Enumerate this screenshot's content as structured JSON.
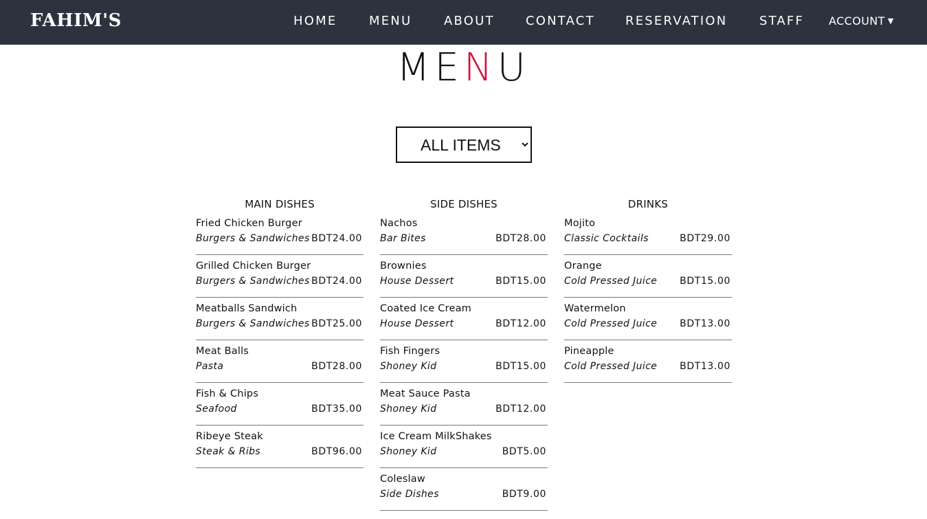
{
  "nav": {
    "brand": "FAHIM'S",
    "links": [
      "HOME",
      "MENU",
      "ABOUT",
      "CONTACT",
      "RESERVATION",
      "STAFF"
    ],
    "account": "ACCOUNT"
  },
  "title": {
    "part1": "ME",
    "accent": "N",
    "part2": "U",
    "accent_color": "#d2163d"
  },
  "filter": {
    "selected": "ALL ITEMS"
  },
  "columns": [
    {
      "heading": "MAIN DISHES",
      "items": [
        {
          "name": "Fried Chicken Burger",
          "category": "Burgers & Sandwiches",
          "price": "BDT24.00"
        },
        {
          "name": "Grilled Chicken Burger",
          "category": "Burgers & Sandwiches",
          "price": "BDT24.00"
        },
        {
          "name": "Meatballs Sandwich",
          "category": "Burgers & Sandwiches",
          "price": "BDT25.00"
        },
        {
          "name": "Meat Balls",
          "category": "Pasta",
          "price": "BDT28.00"
        },
        {
          "name": "Fish & Chips",
          "category": "Seafood",
          "price": "BDT35.00"
        },
        {
          "name": "Ribeye Steak",
          "category": "Steak & Ribs",
          "price": "BDT96.00"
        }
      ]
    },
    {
      "heading": "SIDE DISHES",
      "items": [
        {
          "name": "Nachos",
          "category": "Bar Bites",
          "price": "BDT28.00"
        },
        {
          "name": "Brownies",
          "category": "House Dessert",
          "price": "BDT15.00"
        },
        {
          "name": "Coated Ice Cream",
          "category": "House Dessert",
          "price": "BDT12.00"
        },
        {
          "name": "Fish Fingers",
          "category": "Shoney Kid",
          "price": "BDT15.00"
        },
        {
          "name": "Meat Sauce Pasta",
          "category": "Shoney Kid",
          "price": "BDT12.00"
        },
        {
          "name": "Ice Cream MilkShakes",
          "category": "Shoney Kid",
          "price": "BDT5.00"
        },
        {
          "name": "Coleslaw",
          "category": "Side Dishes",
          "price": "BDT9.00"
        }
      ]
    },
    {
      "heading": "DRINKS",
      "items": [
        {
          "name": "Mojito",
          "category": "Classic Cocktails",
          "price": "BDT29.00"
        },
        {
          "name": "Orange",
          "category": "Cold Pressed Juice",
          "price": "BDT15.00"
        },
        {
          "name": "Watermelon",
          "category": "Cold Pressed Juice",
          "price": "BDT13.00"
        },
        {
          "name": "Pineapple",
          "category": "Cold Pressed Juice",
          "price": "BDT13.00"
        }
      ]
    }
  ]
}
